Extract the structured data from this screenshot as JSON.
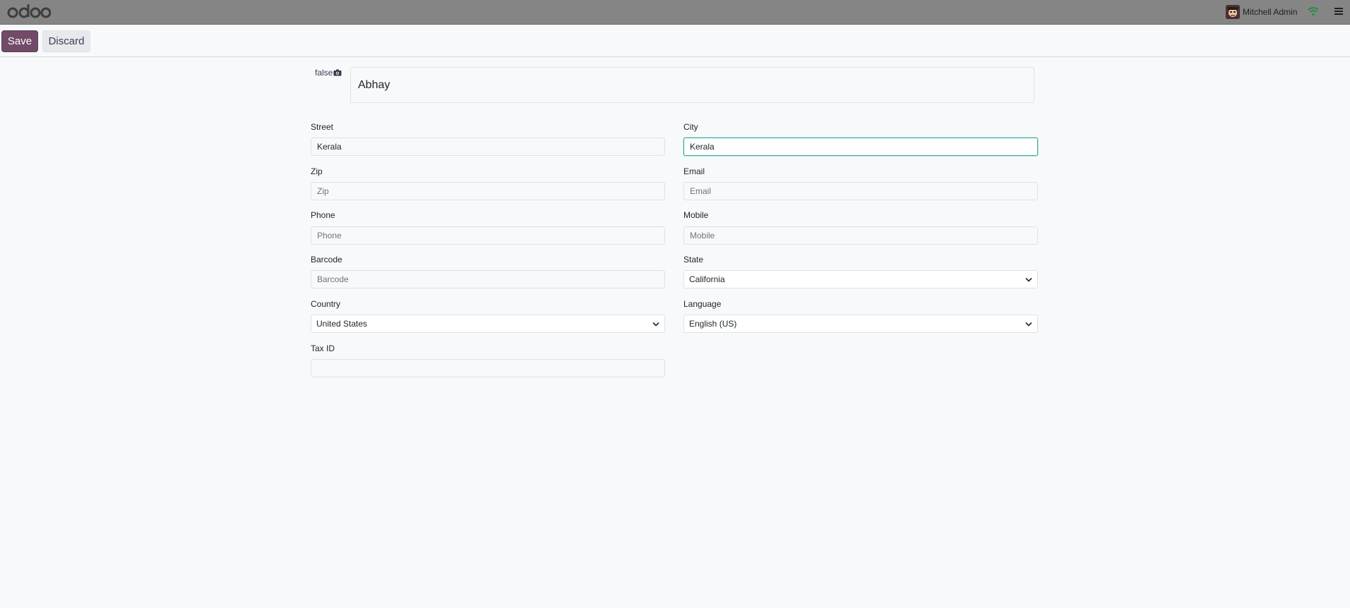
{
  "navbar": {
    "brand": "odoo",
    "user_name": "Mitchell Admin"
  },
  "toolbar": {
    "save_label": "Save",
    "discard_label": "Discard"
  },
  "form": {
    "avatar_placeholder": "false",
    "name_value": "Abhay",
    "street": {
      "label": "Street",
      "value": "Kerala",
      "placeholder": ""
    },
    "city": {
      "label": "City",
      "value": "Kerala",
      "placeholder": ""
    },
    "zip": {
      "label": "Zip",
      "value": "",
      "placeholder": "Zip"
    },
    "email": {
      "label": "Email",
      "value": "",
      "placeholder": "Email"
    },
    "phone": {
      "label": "Phone",
      "value": "",
      "placeholder": "Phone"
    },
    "mobile": {
      "label": "Mobile",
      "value": "",
      "placeholder": "Mobile"
    },
    "barcode": {
      "label": "Barcode",
      "value": "",
      "placeholder": "Barcode"
    },
    "state": {
      "label": "State",
      "selected": "California"
    },
    "country": {
      "label": "Country",
      "selected": "United States"
    },
    "language": {
      "label": "Language",
      "selected": "English (US)"
    },
    "tax_id": {
      "label": "Tax ID",
      "value": "",
      "placeholder": ""
    }
  },
  "colors": {
    "navbar_bg": "#858585",
    "primary": "#714b67",
    "focus": "#3aa8a0",
    "page_bg": "#f8f9fb"
  },
  "icons": [
    "odoo-logo",
    "user-avatar",
    "wifi-icon",
    "hamburger-menu-icon",
    "camera-icon",
    "chevron-down-icon"
  ]
}
